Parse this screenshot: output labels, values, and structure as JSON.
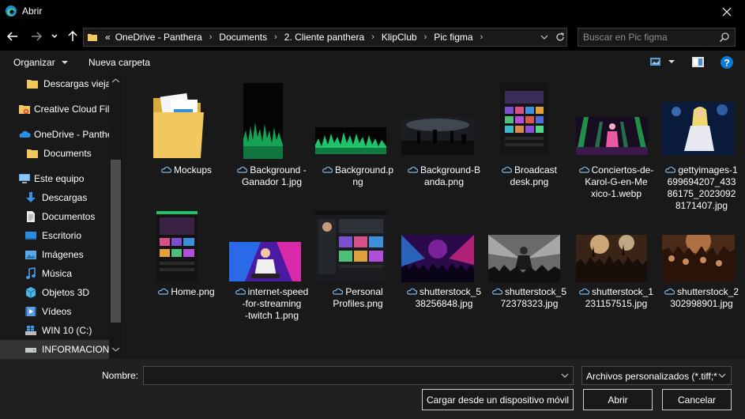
{
  "window": {
    "title": "Abrir"
  },
  "address": {
    "overflow": "«",
    "breadcrumbs": [
      "OneDrive - Panthera",
      "Documents",
      "2. Cliente panthera",
      "KlipClub",
      "Pic figma"
    ]
  },
  "search": {
    "placeholder": "Buscar en Pic figma"
  },
  "toolbar": {
    "organize_label": "Organizar",
    "new_folder_label": "Nueva carpeta"
  },
  "sidebar": {
    "items": [
      {
        "label": "Descargas viejas",
        "icon": "folder-icon"
      },
      {
        "label": "Creative Cloud Fil",
        "icon": "creative-cloud-icon"
      },
      {
        "label": "OneDrive - Panthe",
        "icon": "onedrive-cloud-icon"
      },
      {
        "label": "Documents",
        "icon": "folder-icon"
      },
      {
        "label": "Este equipo",
        "icon": "computer-icon"
      },
      {
        "label": "Descargas",
        "icon": "download-arrow-icon"
      },
      {
        "label": "Documentos",
        "icon": "document-icon"
      },
      {
        "label": "Escritorio",
        "icon": "desktop-icon"
      },
      {
        "label": "Imágenes",
        "icon": "pictures-icon"
      },
      {
        "label": "Música",
        "icon": "music-note-icon"
      },
      {
        "label": "Objetos 3D",
        "icon": "cube-3d-icon"
      },
      {
        "label": "Vídeos",
        "icon": "video-icon"
      },
      {
        "label": "WIN 10 (C:)",
        "icon": "windows-drive-icon"
      },
      {
        "label": "INFORMACION",
        "icon": "drive-icon"
      }
    ]
  },
  "files": [
    {
      "name": [
        "Mockups"
      ],
      "kind": "folder"
    },
    {
      "name": [
        "Background -",
        "Ganador 1.jpg"
      ],
      "kind": "image"
    },
    {
      "name": [
        "Background.p",
        "ng"
      ],
      "kind": "image"
    },
    {
      "name": [
        "Background-B",
        "anda.png"
      ],
      "kind": "image"
    },
    {
      "name": [
        "Broadcast",
        "desk.png"
      ],
      "kind": "image"
    },
    {
      "name": [
        "Conciertos-de-",
        "Karol-G-en-Me",
        "xico-1.webp"
      ],
      "kind": "image"
    },
    {
      "name": [
        "gettyimages-1",
        "699694207_433",
        "86175_2023092",
        "8171407.jpg"
      ],
      "kind": "image"
    },
    {
      "name": [
        "Home.png"
      ],
      "kind": "image"
    },
    {
      "name": [
        "internet-speed",
        "-for-streaming",
        "-twitch 1.png"
      ],
      "kind": "image"
    },
    {
      "name": [
        "Personal",
        "Profiles.png"
      ],
      "kind": "image"
    },
    {
      "name": [
        "shutterstock_5",
        "38256848.jpg"
      ],
      "kind": "image"
    },
    {
      "name": [
        "shutterstock_5",
        "72378323.jpg"
      ],
      "kind": "image"
    },
    {
      "name": [
        "shutterstock_1",
        "231157515.jpg"
      ],
      "kind": "image"
    },
    {
      "name": [
        "shutterstock_2",
        "302998901.jpg"
      ],
      "kind": "image"
    }
  ],
  "footer": {
    "name_label": "Nombre:",
    "name_value": "",
    "filter_label": "Archivos personalizados (*.tiff;*",
    "upload_button": "Cargar desde un dispositivo móvil",
    "open_button": "Abrir",
    "cancel_button": "Cancelar"
  },
  "colors": {
    "background": "#191919",
    "titlebar": "#000000",
    "folder": "#f3c75f",
    "accent_blue": "#0a78d7",
    "cloud": "#7fb6e8"
  }
}
